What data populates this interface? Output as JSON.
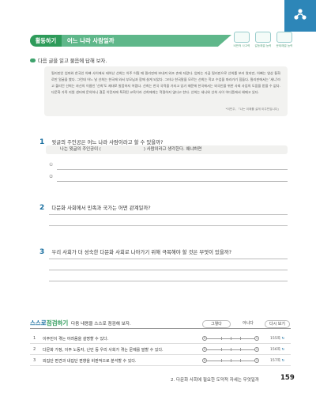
{
  "activity": {
    "tag": "활동하기",
    "title": "어느 나라 사람일까",
    "competencies": [
      "비판적 사고력",
      "갈등해결 능력",
      "문제해결 능력"
    ]
  },
  "instruction": "다음 글을 읽고 물음에 답해 보자.",
  "passage": "필리핀인 엄마와 한국인 아빠 사이에서 태어난 선희는 아주 어릴 때 필리핀에 보내져 외조 손에 자랐다. 엄마는 가끔 필리핀으로 선희를 보러 왔지만, 아빠는 영상 통화로만 얼굴을 봤다. 그런데 어느 날 선희는 한국에 와서 부모님과 함께 살게 되었다. 그러나 한국말을 모르는 선희는 학교 수업을 따라가기 힘들다. 필리핀에서는 '세니'라고 불리던 선희는 자신의 이름인 '선희'도 제대로 발음하지 어렵다. 선희는 한국 국적을 가지고 있기 때문에 한국에서는 외국인을 위한 사회 사업의 도움을 받을 수 없다. 다문화 가족 지원 센터에 문의하니 결혼 이민자에 특화된 교육이라 선희에게는 적절하지 않다고 한다. 선희는 세니와 선희 사이 어디쯤에서 헤매고 있다.",
  "passage_note": "*이민주, 「나는 이제를 살게 이주민입니다」",
  "q1": {
    "num": "1",
    "text": "윗글의 주인공은 어느 나라 사람이라고 할 수 있을까?",
    "prompt_a": "나는 윗글의 주인공이 (",
    "prompt_b": ") 사람이라고 생각한다. 왜냐하면",
    "marks": [
      "①",
      "②"
    ]
  },
  "q2": {
    "num": "2",
    "text": "다문화 사회에서 민족과 국가는 어떤 관계일까?"
  },
  "q3": {
    "num": "3",
    "text": "우리 사회가 더 성숙한 다문화 사회로 나아가기 위해 극복해야 할 것은 무엇이 있을까?"
  },
  "self_check": {
    "title_a": "스스로",
    "title_b": "점검하기",
    "desc": "다음 내용을 스스로 점검해 보자.",
    "col_yes": "그렇다",
    "col_no": "아니다",
    "col_review": "다시 보기",
    "rows": [
      {
        "n": "1",
        "text": "이주민이 겪는 어려움을 설명할 수 있다.",
        "page": "155쪽"
      },
      {
        "n": "2",
        "text": "다문화 가정, 이주 노동자, 난민 등 우리 사회가 겪는 문제를 말할 수 있다.",
        "page": "156쪽"
      },
      {
        "n": "3",
        "text": "외집단 편견과 내집단 편향을 비판적으로 분석할 수 있다.",
        "page": "157쪽"
      }
    ],
    "scale_left": "5",
    "scale_right": "1"
  },
  "footer": {
    "section": "2. 다문화 사회에 필요한 도덕적 자세는 무엇일까",
    "page": "159"
  }
}
